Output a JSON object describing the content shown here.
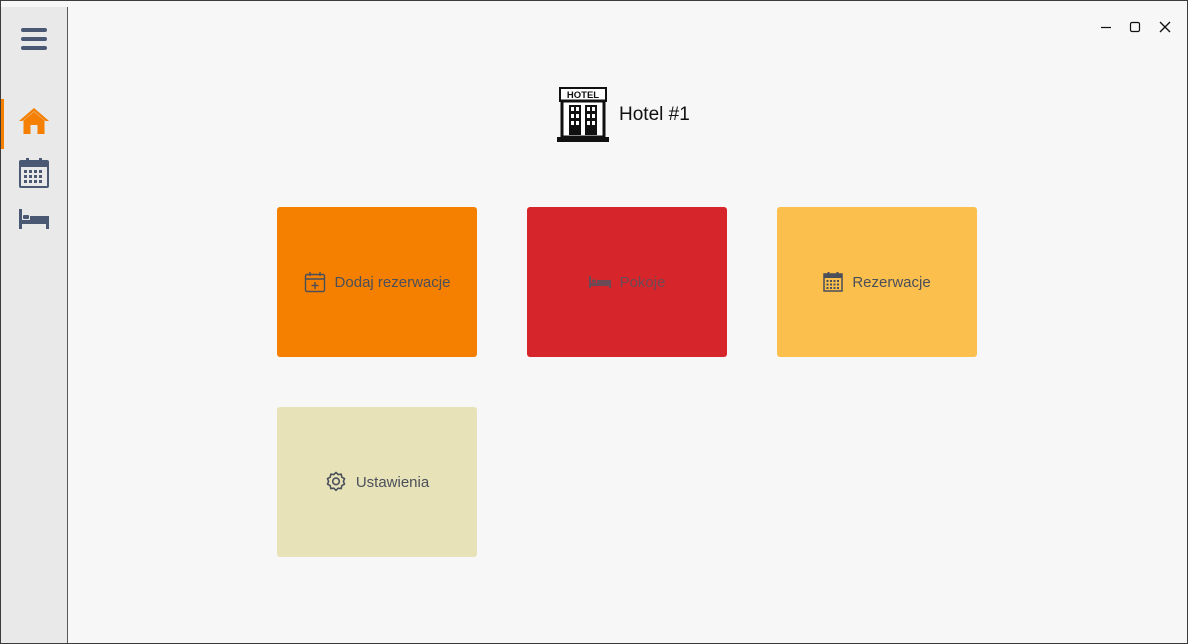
{
  "window": {
    "controls": {
      "minimize_icon": "minimize-icon",
      "maximize_icon": "maximize-icon",
      "close_icon": "close-icon"
    }
  },
  "sidebar": {
    "items": [
      {
        "icon": "hamburger-menu-icon",
        "active": false
      },
      {
        "icon": "home-icon",
        "active": true
      },
      {
        "icon": "calendar-icon",
        "active": false
      },
      {
        "icon": "bed-icon",
        "active": false
      }
    ],
    "active_color": "#f47f00",
    "icon_color": "#4a5874"
  },
  "header": {
    "logo_text": "HOTEL",
    "title": "Hotel #1"
  },
  "tiles": [
    {
      "label": "Dodaj rezerwacje",
      "icon": "calendar-plus-icon",
      "color": "#f58000"
    },
    {
      "label": "Pokoje",
      "icon": "bed-icon",
      "color": "#d7262b"
    },
    {
      "label": "Rezerwacje",
      "icon": "calendar-icon",
      "color": "#fbbf4d"
    },
    {
      "label": "Ustawienia",
      "icon": "gear-icon",
      "color": "#e8e2b9"
    }
  ]
}
